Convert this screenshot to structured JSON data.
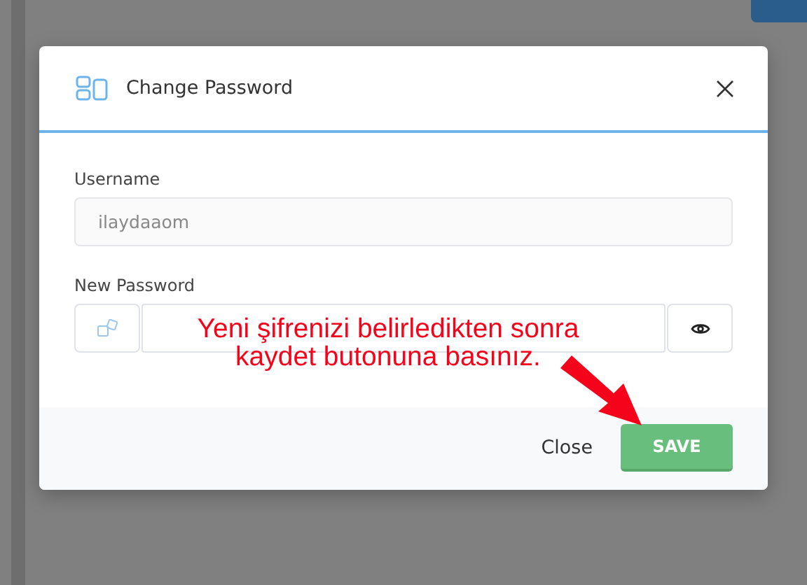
{
  "dialog": {
    "title": "Change Password",
    "fields": [
      {
        "label": "Username",
        "value": "ilaydaaom",
        "disabled": true
      }
    ],
    "password": {
      "label": "New Password"
    },
    "buttons": [
      {
        "label": "Close",
        "kind": "link"
      },
      {
        "label": "SAVE",
        "kind": "primary"
      }
    ]
  },
  "annotation": {
    "lines": [
      "Yeni şifrenizi belirledikten sonra",
      "kaydet butonuna basınız."
    ]
  }
}
